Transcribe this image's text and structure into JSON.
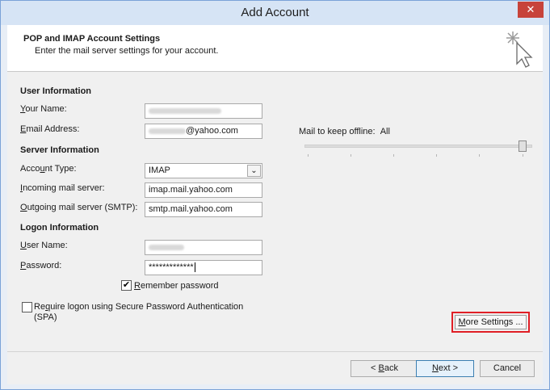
{
  "window": {
    "title": "Add Account",
    "close_glyph": "✕"
  },
  "header": {
    "title": "POP and IMAP Account Settings",
    "subtitle": "Enter the mail server settings for your account.",
    "icon": "wizard-cursor-icon"
  },
  "user_information": {
    "section_label": "User Information",
    "your_name": {
      "label_accel": "Y",
      "label_rest": "our Name:"
    },
    "email_address": {
      "label_accel": "E",
      "label_rest": "mail Address:",
      "value_suffix": "@yahoo.com"
    }
  },
  "server_information": {
    "section_label": "Server Information",
    "account_type": {
      "label_pre": "Acco",
      "label_accel": "u",
      "label_rest": "nt Type:",
      "value": "IMAP"
    },
    "incoming_server": {
      "label_accel": "I",
      "label_rest": "ncoming mail server:",
      "value": "imap.mail.yahoo.com"
    },
    "outgoing_server": {
      "label_accel": "O",
      "label_rest": "utgoing mail server (SMTP):",
      "value": "smtp.mail.yahoo.com"
    }
  },
  "logon_information": {
    "section_label": "Logon Information",
    "user_name": {
      "label_accel": "U",
      "label_rest": "ser Name:"
    },
    "password": {
      "label_accel": "P",
      "label_rest": "assword:",
      "value": "*************"
    },
    "remember_password": {
      "label_accel": "R",
      "label_rest": "emember password",
      "checked": true
    },
    "spa": {
      "label_pre": "Re",
      "label_accel": "q",
      "label_rest": "uire logon using Secure Password Authentication",
      "label_line2": "(SPA)",
      "checked": false
    }
  },
  "offline": {
    "label": "Mail to keep offline:",
    "value": "All"
  },
  "buttons": {
    "more_settings": {
      "label_accel": "M",
      "label_rest": "ore Settings ..."
    },
    "back": {
      "label_pre": "< ",
      "label_accel": "B",
      "label_rest": "ack"
    },
    "next": {
      "label_accel": "N",
      "label_rest": "ext >"
    },
    "cancel": "Cancel"
  },
  "accent_colors": {
    "highlight_border": "#e01f26",
    "close_button": "#c7433a",
    "title_bar": "#d6e4f5"
  }
}
